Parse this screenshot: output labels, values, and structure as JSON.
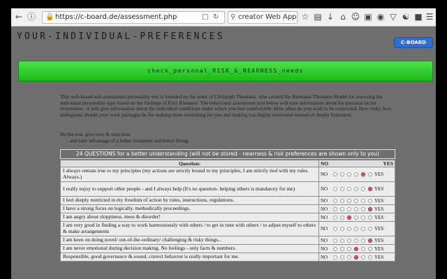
{
  "browser": {
    "url": "https://c-board.de/assessment.php",
    "search_text": "creator Web App Ma"
  },
  "header": {
    "site_title": "YOUR-INDIVIDUAL-PREFERENCES",
    "cboard_label": "C-BOARD"
  },
  "check_bar": {
    "label": "check_personal_RISK_&_NEARNESS_needs"
  },
  "intro": {
    "text": "This web-based self-assessment personality test is founded on the work of Christoph Thomann, who created the Riemann-Thomann Model for assessing the individual personality-type based on the findings of Fritz Riemann. The behavioral assessment tool below will type information about the personal factor orientation - it will give information about the individual conditions under which you feel comfortable: How often do you wish to be connected. How risky, how ambiguous should your work packages be for making them interesting for you and making you highly motivated instead of deeply frustrated.",
    "tip1": "Do the test: give trust & earn trust",
    "tip2": "- and take advantage of a better treatment and better fitting"
  },
  "questions_header": "24 QUESTIONS for a better understanding (will not be stored - nearness & risk preferences are shown only to you)",
  "table": {
    "col_question": "Question:",
    "col_no": "NO",
    "col_yes": "YES",
    "no_label": "NO",
    "yes_label": "YES",
    "rows": [
      {
        "text": "I always remain true to my principles (my actions are strictly bound to my principles, I am strictly tied with my rules. Always.)",
        "selected": 4
      },
      {
        "text": "I really enjoy to support other people - and I always help (It's no question- helping others is mandatory for me)",
        "selected": 5
      },
      {
        "text": "I feel deeply restricted in my freedom of action by rules, instructions, regulations.",
        "selected": -1
      },
      {
        "text": "I have a strong focus on logically, methodically proceedings.",
        "selected": 5
      },
      {
        "text": "I am angry about sloppiness, mess & disorder!",
        "selected": 2
      },
      {
        "text": "I am very good in finding a way to work harmoniously with others / to get in tune with others / to adjust myself to others & make arrangements",
        "selected": -1
      },
      {
        "text": "I am keen on doing novel/ out-of-the-ordinary/ challenging & risky things...",
        "selected": 5
      },
      {
        "text": "I am never emotional during decision making. No feelings - only facts & numbers.",
        "selected": 3
      },
      {
        "text": "Responsible, good governance & sound, correct behavior is really important for me.",
        "selected": 3
      }
    ]
  }
}
